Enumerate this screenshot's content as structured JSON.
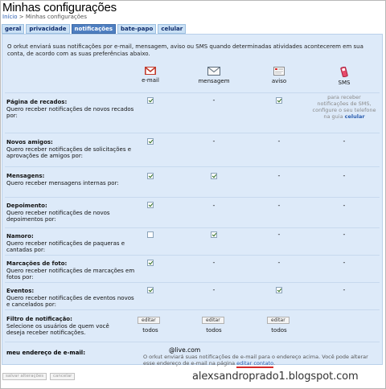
{
  "page": {
    "title": "Minhas configurações",
    "breadcrumb": {
      "home": "Início",
      "sep": " > ",
      "current": "Minhas configurações"
    }
  },
  "tabs": [
    {
      "label": "geral",
      "active": false
    },
    {
      "label": "privacidade",
      "active": false
    },
    {
      "label": "notificações",
      "active": true
    },
    {
      "label": "bate-papo",
      "active": false
    },
    {
      "label": "celular",
      "active": false
    }
  ],
  "intro": "O orkut enviará suas notificações por e-mail, mensagem, aviso ou SMS quando determinadas atividades acontecerem em sua conta, de acordo com as suas preferências abaixo.",
  "columns": [
    {
      "label": "e-mail",
      "icon": "gmail-icon"
    },
    {
      "label": "mensagem",
      "icon": "envelope-icon"
    },
    {
      "label": "aviso",
      "icon": "notice-icon"
    },
    {
      "label": "SMS",
      "icon": "phone-icon"
    }
  ],
  "rows": [
    {
      "title": "Página de recados:",
      "desc": "Quero receber notificações de novos recados por:",
      "email": true,
      "mensagem": null,
      "aviso": true
    },
    {
      "title": "Novos amigos:",
      "desc": "Quero receber notificações de solicitações e aprovações de amigos por:",
      "email": true,
      "mensagem": null,
      "aviso": null
    },
    {
      "title": "Mensagens:",
      "desc": "Quero receber mensagens internas por:",
      "email": true,
      "mensagem": true,
      "aviso": null
    },
    {
      "title": "Depoimento:",
      "desc": "Quero receber notificações de novos depoimentos por:",
      "email": true,
      "mensagem": null,
      "aviso": null
    },
    {
      "title": "Namoro:",
      "desc": "Quero receber notificações de paqueras e cantadas por:",
      "email": false,
      "mensagem": true,
      "aviso": null
    },
    {
      "title": "Marcações de foto:",
      "desc": "Quero receber notificações de marcações em fotos por:",
      "email": true,
      "mensagem": null,
      "aviso": null
    },
    {
      "title": "Eventos:",
      "desc": "Quero receber notificações de eventos novos e cancelados por:",
      "email": true,
      "mensagem": null,
      "aviso": true
    }
  ],
  "dash": "-",
  "sms_note": {
    "text": "para receber notificações de SMS, configure o seu telefone na guia",
    "link": "celular"
  },
  "filter": {
    "title": "Filtro de notificação:",
    "desc": "Selecione os usuários de quem você deseja receber notificações.",
    "edit_label": "editar",
    "value": "todos"
  },
  "email_section": {
    "label": "meu endereço de e-mail:",
    "value": "@live.com",
    "note": "O orkut enviará suas notificações de e-mail para o endereço acima. Você pode alterar esse endereço de e-mail na página",
    "link": "editar contato",
    "period": "."
  },
  "buttons": {
    "save": "salvar alterações",
    "cancel": "cancelar"
  },
  "watermark": "alexsandroprado1.blogspot.com",
  "colors": {
    "tab_active": "#4f7fc1",
    "tab_bg": "#cbe1f5",
    "panel_bg": "#ddeaf9",
    "gmail_red": "#c0392b",
    "link": "#2a5db0",
    "underline": "#d42a2a"
  }
}
